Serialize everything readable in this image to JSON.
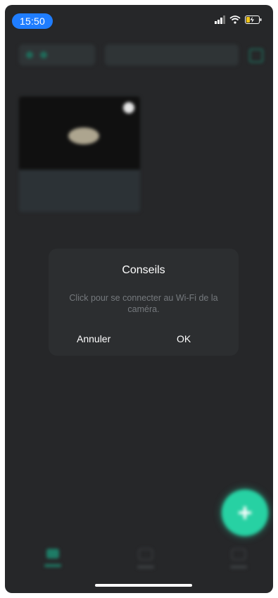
{
  "status_bar": {
    "time": "15:50",
    "icons": [
      "signal-icon",
      "wifi-icon",
      "battery-charging-icon"
    ]
  },
  "dialog": {
    "title": "Conseils",
    "message": "Click pour se connecter au Wi-Fi de la caméra.",
    "cancel_label": "Annuler",
    "ok_label": "OK"
  },
  "fab": {
    "icon": "plus-icon"
  },
  "tab_bar": {
    "items": [
      {
        "icon": "home-icon",
        "active": true
      },
      {
        "icon": "cloud-icon",
        "active": false
      },
      {
        "icon": "user-icon",
        "active": false
      }
    ]
  },
  "colors": {
    "background": "#262729",
    "accent": "#27d1a3",
    "time_pill": "#1f7dff",
    "dialog_bg": "#2c2e30"
  }
}
